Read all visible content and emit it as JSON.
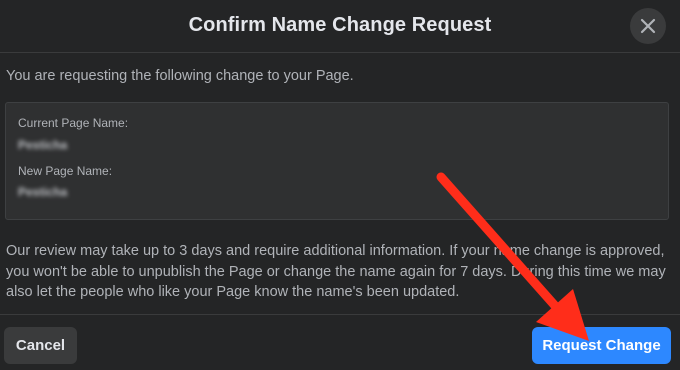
{
  "dialog": {
    "title": "Confirm Name Change Request",
    "close_icon": "close-icon",
    "intro": "You are requesting the following change to your Page.",
    "current_name_label": "Current Page Name:",
    "current_name_value": "Pesticha",
    "new_name_label": "New Page Name:",
    "new_name_value": "Pesticha",
    "note": "Our review may take up to 3 days and require additional information. If your name change is approved, you won't be able to unpublish the Page or change the name again for 7 days. During this time we may also let the people who like your Page know the name's been updated.",
    "cancel_label": "Cancel",
    "request_label": "Request Change"
  },
  "colors": {
    "background": "#242526",
    "primary_button": "#2d88ff",
    "arrow": "#ff2d1a"
  }
}
